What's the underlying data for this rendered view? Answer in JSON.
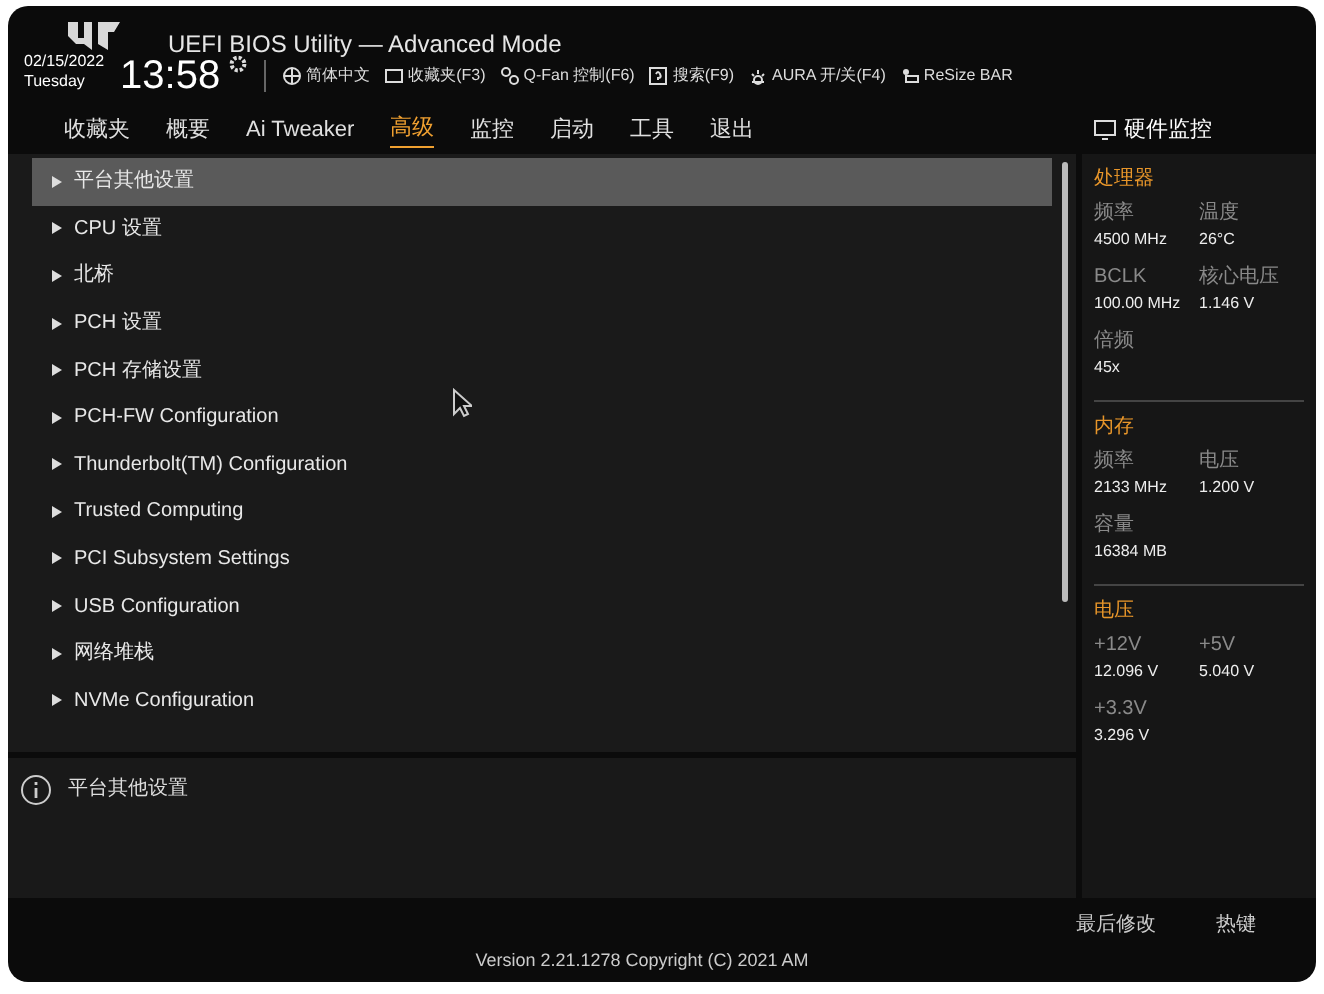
{
  "header": {
    "title": "UEFI BIOS Utility — Advanced Mode",
    "date": "02/15/2022",
    "day": "Tuesday",
    "time": "13:58",
    "toolbar": [
      {
        "kind": "globe",
        "label": "简体中文"
      },
      {
        "kind": "folder",
        "label": "收藏夹(F3)"
      },
      {
        "kind": "fan",
        "label": "Q-Fan 控制(F6)"
      },
      {
        "kind": "help",
        "label": "搜索(F9)"
      },
      {
        "kind": "light",
        "label": "AURA 开/关(F4)"
      },
      {
        "kind": "bar",
        "label": "ReSize BAR"
      }
    ]
  },
  "tabs": [
    {
      "label": "收藏夹",
      "selected": false
    },
    {
      "label": "概要",
      "selected": false
    },
    {
      "label": "Ai Tweaker",
      "selected": false
    },
    {
      "label": "高级",
      "selected": true
    },
    {
      "label": "监控",
      "selected": false
    },
    {
      "label": "启动",
      "selected": false
    },
    {
      "label": "工具",
      "selected": false
    },
    {
      "label": "退出",
      "selected": false
    }
  ],
  "menu": [
    {
      "label": "平台其他设置",
      "selected": true
    },
    {
      "label": "CPU 设置",
      "selected": false
    },
    {
      "label": "北桥",
      "selected": false
    },
    {
      "label": "PCH 设置",
      "selected": false
    },
    {
      "label": "PCH 存储设置",
      "selected": false
    },
    {
      "label": "PCH-FW Configuration",
      "selected": false
    },
    {
      "label": "Thunderbolt(TM) Configuration",
      "selected": false
    },
    {
      "label": "Trusted Computing",
      "selected": false
    },
    {
      "label": "PCI Subsystem Settings",
      "selected": false
    },
    {
      "label": "USB Configuration",
      "selected": false
    },
    {
      "label": "网络堆栈",
      "selected": false
    },
    {
      "label": "NVMe Configuration",
      "selected": false
    }
  ],
  "info": {
    "text": "平台其他设置"
  },
  "monitor": {
    "title": "硬件监控",
    "sections": [
      {
        "title": "处理器",
        "rows": [
          [
            {
              "label": "频率",
              "value": "4500 MHz"
            },
            {
              "label": "温度",
              "value": "26°C"
            }
          ],
          [
            {
              "label": "BCLK",
              "value": "100.00 MHz"
            },
            {
              "label": "核心电压",
              "value": "1.146 V"
            }
          ],
          [
            {
              "label": "倍频",
              "value": "45x"
            }
          ]
        ]
      },
      {
        "title": "内存",
        "rows": [
          [
            {
              "label": "频率",
              "value": "2133 MHz"
            },
            {
              "label": "电压",
              "value": "1.200 V"
            }
          ],
          [
            {
              "label": "容量",
              "value": "16384 MB"
            }
          ]
        ]
      },
      {
        "title": "电压",
        "rows": [
          [
            {
              "label": "+12V",
              "value": "12.096 V"
            },
            {
              "label": "+5V",
              "value": "5.040 V"
            }
          ],
          [
            {
              "label": "+3.3V",
              "value": "3.296 V"
            }
          ]
        ]
      }
    ]
  },
  "footer": {
    "version": "Version 2.21.1278 Copyright (C) 2021 AM",
    "actions": [
      "最后修改",
      "热键"
    ]
  }
}
